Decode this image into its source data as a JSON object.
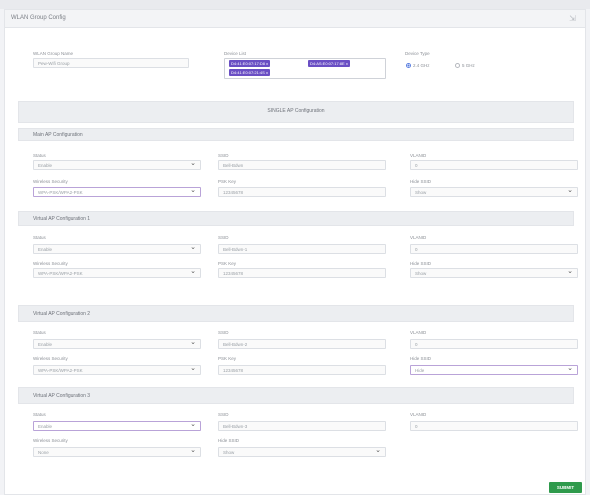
{
  "header": {
    "title": "WLAN Group Config",
    "expand_icon": "expand-icon"
  },
  "group": {
    "name_label": "WLAN Group Name",
    "name_value": "Pew-Wifi Group",
    "device_list_label": "Device List",
    "devices": [
      "D4:41:E0:07:17:D8",
      "D4:AS:E0:07:17:8E",
      "D4:41:E0:07:21:4S"
    ],
    "device_tags": [
      "x",
      "x",
      "x"
    ],
    "device_type_label": "Device Type",
    "radio_options": [
      "2.4 GHz",
      "5 GHz"
    ],
    "radio_selected": "2.4 GHz"
  },
  "single_ap_title": "SINGLE AP Configuration",
  "main_ap": {
    "title": "Main AP Configuration",
    "status_label": "Status",
    "status_value": "Enable",
    "ssid_label": "SSID",
    "ssid_value": "Bell-Bdwn",
    "vlan_label": "VLANID",
    "vlan_value": "0",
    "security_label": "Wireless Security",
    "security_value": "WPA-PSK/WPA2-PSK",
    "psk_label": "PSK Key",
    "psk_value": "12345678",
    "hide_label": "Hide SSID",
    "hide_value": "Show"
  },
  "virtual_1": {
    "title": "Virtual AP Configuration 1",
    "status_label": "Status",
    "status_value": "Enable",
    "ssid_label": "SSID",
    "ssid_value": "Bell-Bdwn-1",
    "vlan_label": "VLANID",
    "vlan_value": "0",
    "security_label": "Wireless Security",
    "security_value": "WPA-PSK/WPA2-PSK",
    "psk_label": "PSK Key",
    "psk_value": "12345678",
    "hide_label": "Hide SSID",
    "hide_value": "Show"
  },
  "virtual_2": {
    "title": "Virtual AP Configuration 2",
    "status_label": "Status",
    "status_value": "Enable",
    "ssid_label": "SSID",
    "ssid_value": "Bell-Bdwn-2",
    "vlan_label": "VLANID",
    "vlan_value": "0",
    "security_label": "Wireless Security",
    "security_value": "WPA-PSK/WPA2-PSK",
    "psk_label": "PSK Key",
    "psk_value": "12345678",
    "hide_label": "Hide SSID",
    "hide_value": "Hide"
  },
  "virtual_3": {
    "title": "Virtual AP Configuration 3",
    "status_label": "Status",
    "status_value": "Enable",
    "ssid_label": "SSID",
    "ssid_value": "Bell-Bdwn-3",
    "vlan_label": "VLANID",
    "vlan_value": "0",
    "security_label": "Wireless Security",
    "security_value": "None",
    "hide_label": "Hide SSID",
    "hide_value": "Show"
  },
  "submit_label": "SUBMIT",
  "colors": {
    "accent": "#6a4fc4",
    "submit": "#2f9a4c",
    "radio": "#5b7fe0"
  }
}
